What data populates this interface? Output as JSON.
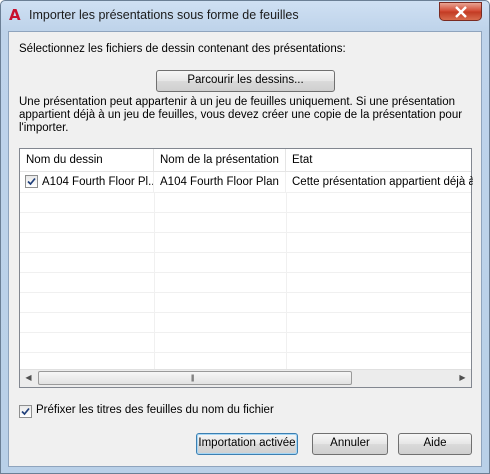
{
  "window": {
    "title": "Importer les présentations sous forme de feuilles",
    "app_icon": "autocad-icon"
  },
  "dialog": {
    "select_label": "Sélectionnez les fichiers de dessin contenant des présentations:",
    "browse_button": "Parcourir les dessins...",
    "info_text": "Une présentation peut appartenir à un jeu de feuilles uniquement. Si une présentation appartient déjà à un jeu de feuilles, vous devez créer une copie de la présentation pour l'importer.",
    "table": {
      "columns": [
        "Nom du dessin",
        "Nom de la présentation",
        "Etat"
      ],
      "rows": [
        {
          "checked": true,
          "drawing": "A104 Fourth Floor Pl...",
          "layout": "A104 Fourth Floor Plan",
          "status": "Cette présentation appartient déjà à"
        }
      ]
    },
    "prefix_checkbox": {
      "checked": true,
      "label": "Préfixer les titres des feuilles du nom du fichier"
    },
    "buttons": {
      "ok": "Importation activée",
      "cancel": "Annuler",
      "help": "Aide"
    }
  },
  "colors": {
    "accent": "#c8102e",
    "close": "#c23a22",
    "titlebar": "#bed3ea"
  }
}
